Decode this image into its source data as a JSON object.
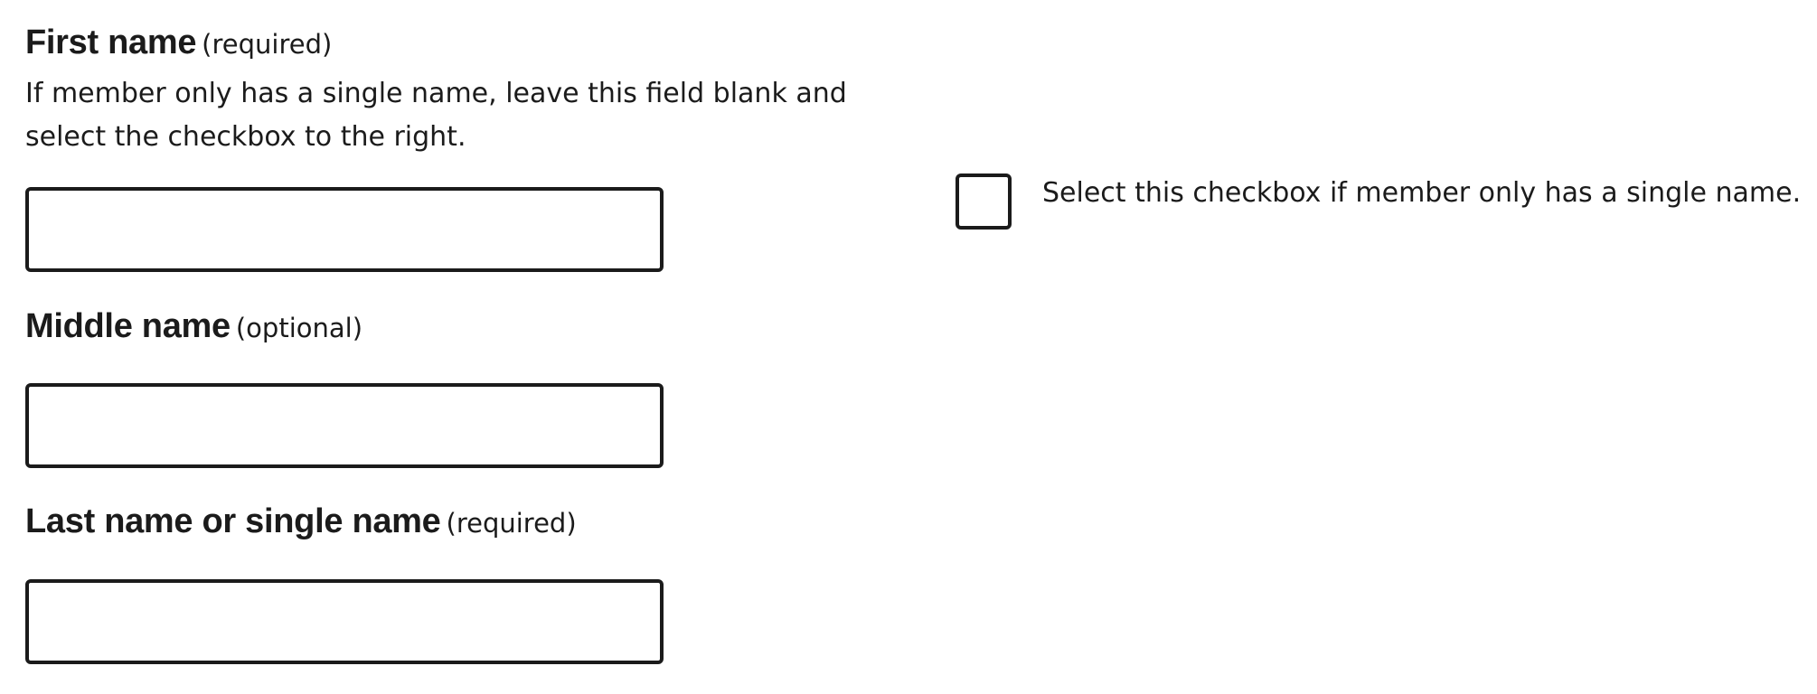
{
  "first_name": {
    "label": "First name",
    "note": "(required)",
    "hint_line_1": "If member only has a single name, leave this field blank and",
    "hint_line_2": "select the checkbox to the right.",
    "value": ""
  },
  "single_name_checkbox": {
    "label": "Select this checkbox if member only has a single name.",
    "checked": false
  },
  "middle_name": {
    "label": "Middle name",
    "note": "(optional)",
    "value": ""
  },
  "last_name": {
    "label": "Last name or single name",
    "note": "(required)",
    "value": ""
  }
}
